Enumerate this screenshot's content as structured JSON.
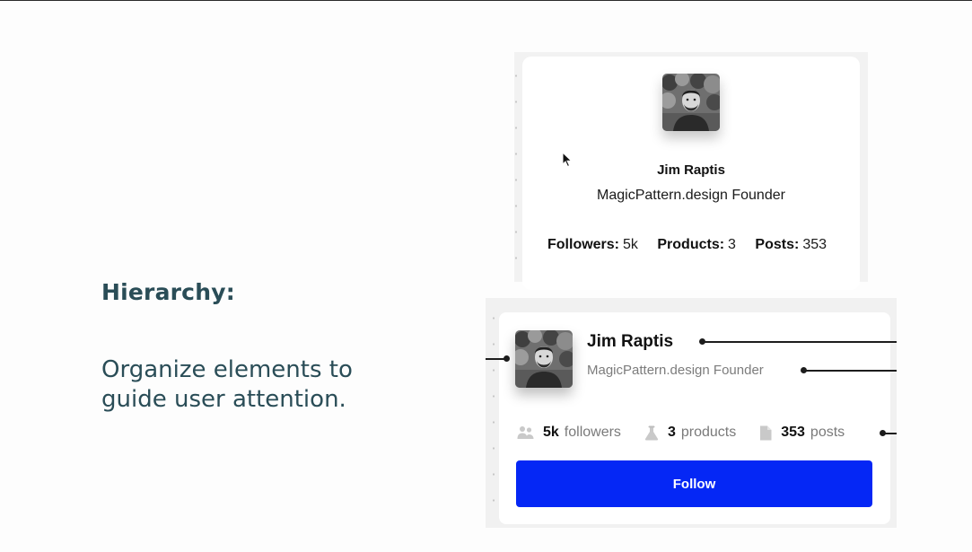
{
  "left": {
    "heading": "Hierarchy:",
    "subtext": "Organize elements to guide user attention."
  },
  "card_before": {
    "name": "Jim Raptis",
    "role": "MagicPattern.design Founder",
    "stats": [
      {
        "label": "Followers:",
        "value": "5k"
      },
      {
        "label": "Products:",
        "value": "3"
      },
      {
        "label": "Posts:",
        "value": "353"
      }
    ]
  },
  "card_after": {
    "name": "Jim Raptis",
    "role": "MagicPattern.design Founder",
    "stats": [
      {
        "icon": "users-icon",
        "value": "5k",
        "label": "followers"
      },
      {
        "icon": "flask-icon",
        "value": "3",
        "label": "products"
      },
      {
        "icon": "document-icon",
        "value": "353",
        "label": "posts"
      }
    ],
    "follow_label": "Follow"
  },
  "colors": {
    "heading": "#2a4d57",
    "button": "#0527f5"
  }
}
